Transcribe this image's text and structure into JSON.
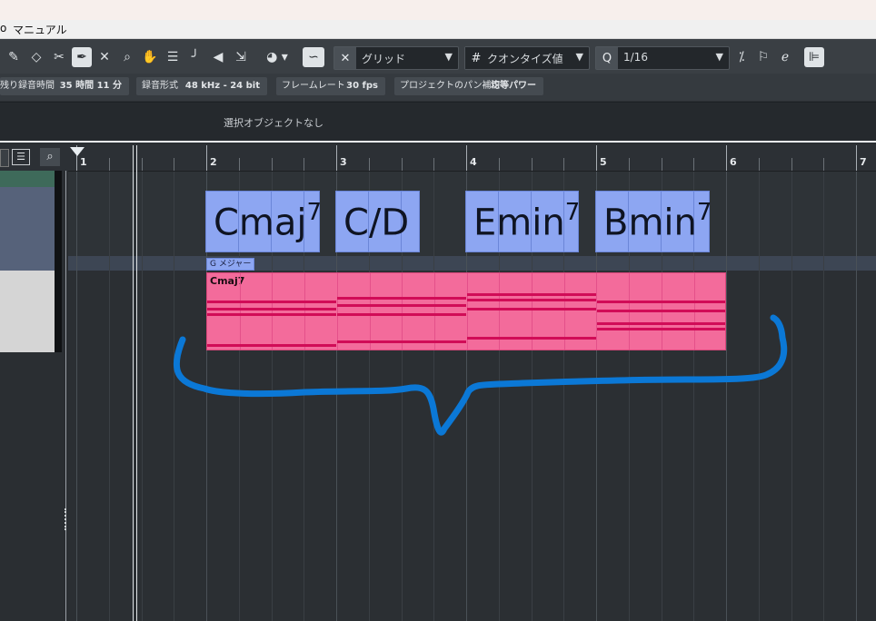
{
  "menu": {
    "partial_item": "o",
    "manual": "マニュアル"
  },
  "toolbar": {
    "tools": [
      "pencil-icon",
      "eraser-icon",
      "scissors-icon",
      "glue-icon",
      "mute-x-icon",
      "zoom-icon",
      "hand-icon",
      "comb-icon",
      "line-icon",
      "speaker-icon",
      "color-tool-icon"
    ],
    "grid_label": "グリッド",
    "quantize_type_label": "クオンタイズ値",
    "quantize_value": "1/16"
  },
  "infoline": {
    "remaining_label": "残り録音時間",
    "remaining_value": "35 時間 11 分",
    "format_label": "録音形式",
    "format_value": "48 kHz - 24 bit",
    "framerate_label": "フレームレート",
    "framerate_value": "30 fps",
    "pan_label": "プロジェクトのパン補正",
    "pan_value": "均等パワー"
  },
  "selection": {
    "text": "選択オブジェクトなし"
  },
  "ruler": {
    "bars": [
      "1",
      "2",
      "3",
      "4",
      "5",
      "6",
      "7"
    ]
  },
  "chords": [
    {
      "root": "Cmaj",
      "ext": "7"
    },
    {
      "root": "C/D",
      "ext": ""
    },
    {
      "root": "Emin",
      "ext": "7"
    },
    {
      "root": "Bmin",
      "ext": "7"
    }
  ],
  "scale": {
    "label": "G メジャー"
  },
  "midi_part": {
    "name": "Cmaj7"
  },
  "colors": {
    "chord": "#8da6f2",
    "midi": "#f36b9b",
    "note": "#d10c57",
    "annotation": "#0b78d6"
  }
}
